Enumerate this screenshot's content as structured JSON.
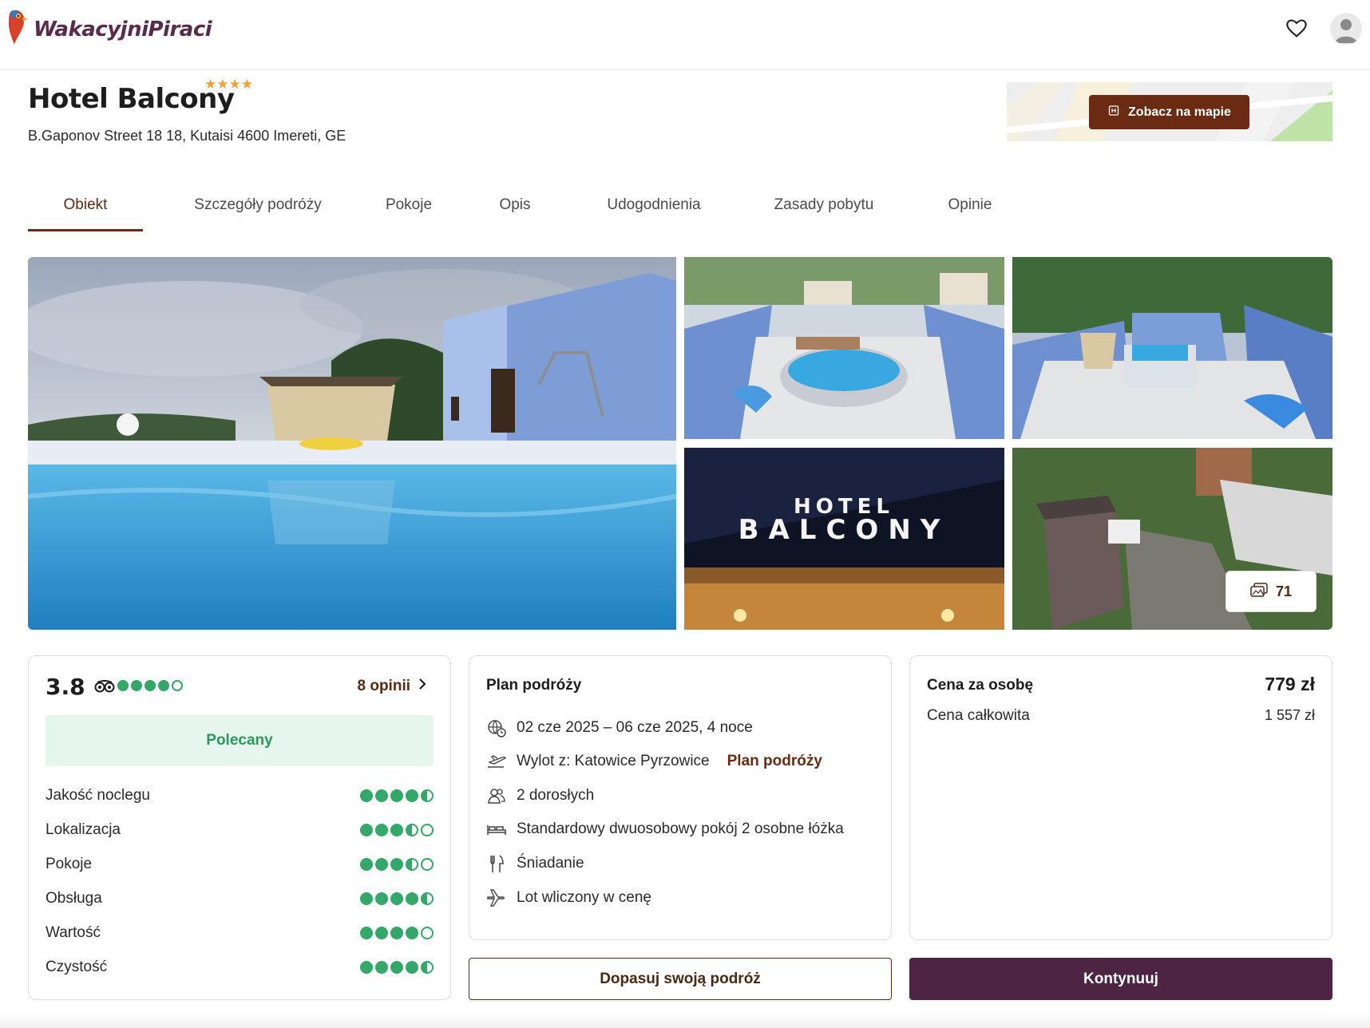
{
  "header": {
    "logo_text": "WakacyjniPiraci",
    "icons": [
      "heart-icon",
      "user-icon"
    ]
  },
  "hotel": {
    "name": "Hotel Balcony",
    "stars": "★★★★",
    "star_count": 4,
    "address": "B.Gaponov Street 18 18, Kutaisi 4600 Imereti, GE"
  },
  "map": {
    "button_label": "Zobacz na mapie"
  },
  "tabs": [
    {
      "label": "Obiekt",
      "active": true
    },
    {
      "label": "Szczegóły podróży"
    },
    {
      "label": "Pokoje"
    },
    {
      "label": "Opis"
    },
    {
      "label": "Udogodnienia"
    },
    {
      "label": "Zasady pobytu"
    },
    {
      "label": "Opinie"
    }
  ],
  "gallery": {
    "photo_count": "71",
    "sign_line1": "HOTEL",
    "sign_line2": "BALCONY"
  },
  "rating": {
    "value": "3.8",
    "tripadvisor_bubbles": 4,
    "reviews_link": "8 opinii",
    "badge": "Polecany",
    "criteria": [
      {
        "label": "Jakość noclegu",
        "score": 4.5
      },
      {
        "label": "Lokalizacja",
        "score": 3.5
      },
      {
        "label": "Pokoje",
        "score": 3.5
      },
      {
        "label": "Obsługa",
        "score": 4.5
      },
      {
        "label": "Wartość",
        "score": 4
      },
      {
        "label": "Czystość",
        "score": 4.5
      }
    ]
  },
  "plan": {
    "title": "Plan podróży",
    "dates": "02 cze 2025 – 06 cze 2025, 4 noce",
    "flight": "Wylot z: Katowice Pyrzowice",
    "flight_link": "Plan podróży",
    "guests": "2 dorosłych",
    "room": "Standardowy dwuosobowy pokój 2 osobne łóżka",
    "board": "Śniadanie",
    "flight_included": "Lot wliczony w cenę"
  },
  "price": {
    "per_person_label": "Cena za osobę",
    "per_person_value": "779 zł",
    "total_label": "Cena całkowita",
    "total_value": "1 557 zł"
  },
  "actions": {
    "adjust_label": "Dopasuj swoją podróż",
    "continue_label": "Kontynuuj"
  },
  "colors": {
    "brand_brown": "#6b2a12",
    "brand_plum": "#4e2443",
    "rating_green": "#34a868"
  }
}
